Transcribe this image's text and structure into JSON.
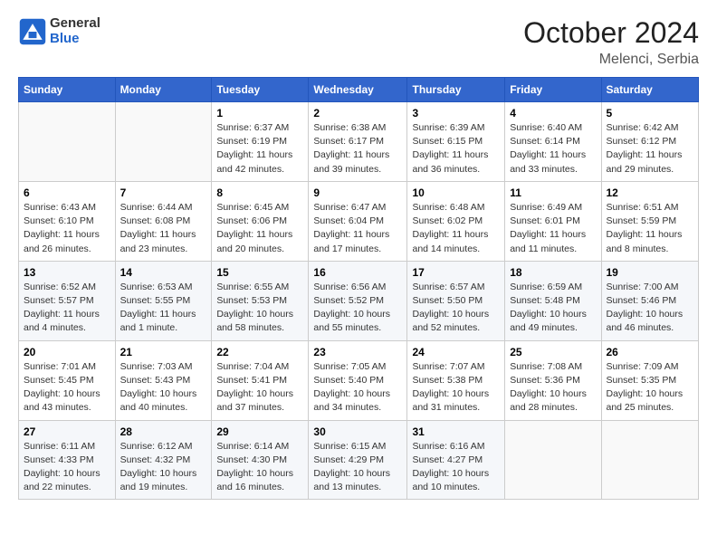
{
  "header": {
    "logo_general": "General",
    "logo_blue": "Blue",
    "month": "October 2024",
    "location": "Melenci, Serbia"
  },
  "weekdays": [
    "Sunday",
    "Monday",
    "Tuesday",
    "Wednesday",
    "Thursday",
    "Friday",
    "Saturday"
  ],
  "weeks": [
    [
      {
        "day": "",
        "info": ""
      },
      {
        "day": "",
        "info": ""
      },
      {
        "day": "1",
        "info": "Sunrise: 6:37 AM\nSunset: 6:19 PM\nDaylight: 11 hours and 42 minutes."
      },
      {
        "day": "2",
        "info": "Sunrise: 6:38 AM\nSunset: 6:17 PM\nDaylight: 11 hours and 39 minutes."
      },
      {
        "day": "3",
        "info": "Sunrise: 6:39 AM\nSunset: 6:15 PM\nDaylight: 11 hours and 36 minutes."
      },
      {
        "day": "4",
        "info": "Sunrise: 6:40 AM\nSunset: 6:14 PM\nDaylight: 11 hours and 33 minutes."
      },
      {
        "day": "5",
        "info": "Sunrise: 6:42 AM\nSunset: 6:12 PM\nDaylight: 11 hours and 29 minutes."
      }
    ],
    [
      {
        "day": "6",
        "info": "Sunrise: 6:43 AM\nSunset: 6:10 PM\nDaylight: 11 hours and 26 minutes."
      },
      {
        "day": "7",
        "info": "Sunrise: 6:44 AM\nSunset: 6:08 PM\nDaylight: 11 hours and 23 minutes."
      },
      {
        "day": "8",
        "info": "Sunrise: 6:45 AM\nSunset: 6:06 PM\nDaylight: 11 hours and 20 minutes."
      },
      {
        "day": "9",
        "info": "Sunrise: 6:47 AM\nSunset: 6:04 PM\nDaylight: 11 hours and 17 minutes."
      },
      {
        "day": "10",
        "info": "Sunrise: 6:48 AM\nSunset: 6:02 PM\nDaylight: 11 hours and 14 minutes."
      },
      {
        "day": "11",
        "info": "Sunrise: 6:49 AM\nSunset: 6:01 PM\nDaylight: 11 hours and 11 minutes."
      },
      {
        "day": "12",
        "info": "Sunrise: 6:51 AM\nSunset: 5:59 PM\nDaylight: 11 hours and 8 minutes."
      }
    ],
    [
      {
        "day": "13",
        "info": "Sunrise: 6:52 AM\nSunset: 5:57 PM\nDaylight: 11 hours and 4 minutes."
      },
      {
        "day": "14",
        "info": "Sunrise: 6:53 AM\nSunset: 5:55 PM\nDaylight: 11 hours and 1 minute."
      },
      {
        "day": "15",
        "info": "Sunrise: 6:55 AM\nSunset: 5:53 PM\nDaylight: 10 hours and 58 minutes."
      },
      {
        "day": "16",
        "info": "Sunrise: 6:56 AM\nSunset: 5:52 PM\nDaylight: 10 hours and 55 minutes."
      },
      {
        "day": "17",
        "info": "Sunrise: 6:57 AM\nSunset: 5:50 PM\nDaylight: 10 hours and 52 minutes."
      },
      {
        "day": "18",
        "info": "Sunrise: 6:59 AM\nSunset: 5:48 PM\nDaylight: 10 hours and 49 minutes."
      },
      {
        "day": "19",
        "info": "Sunrise: 7:00 AM\nSunset: 5:46 PM\nDaylight: 10 hours and 46 minutes."
      }
    ],
    [
      {
        "day": "20",
        "info": "Sunrise: 7:01 AM\nSunset: 5:45 PM\nDaylight: 10 hours and 43 minutes."
      },
      {
        "day": "21",
        "info": "Sunrise: 7:03 AM\nSunset: 5:43 PM\nDaylight: 10 hours and 40 minutes."
      },
      {
        "day": "22",
        "info": "Sunrise: 7:04 AM\nSunset: 5:41 PM\nDaylight: 10 hours and 37 minutes."
      },
      {
        "day": "23",
        "info": "Sunrise: 7:05 AM\nSunset: 5:40 PM\nDaylight: 10 hours and 34 minutes."
      },
      {
        "day": "24",
        "info": "Sunrise: 7:07 AM\nSunset: 5:38 PM\nDaylight: 10 hours and 31 minutes."
      },
      {
        "day": "25",
        "info": "Sunrise: 7:08 AM\nSunset: 5:36 PM\nDaylight: 10 hours and 28 minutes."
      },
      {
        "day": "26",
        "info": "Sunrise: 7:09 AM\nSunset: 5:35 PM\nDaylight: 10 hours and 25 minutes."
      }
    ],
    [
      {
        "day": "27",
        "info": "Sunrise: 6:11 AM\nSunset: 4:33 PM\nDaylight: 10 hours and 22 minutes."
      },
      {
        "day": "28",
        "info": "Sunrise: 6:12 AM\nSunset: 4:32 PM\nDaylight: 10 hours and 19 minutes."
      },
      {
        "day": "29",
        "info": "Sunrise: 6:14 AM\nSunset: 4:30 PM\nDaylight: 10 hours and 16 minutes."
      },
      {
        "day": "30",
        "info": "Sunrise: 6:15 AM\nSunset: 4:29 PM\nDaylight: 10 hours and 13 minutes."
      },
      {
        "day": "31",
        "info": "Sunrise: 6:16 AM\nSunset: 4:27 PM\nDaylight: 10 hours and 10 minutes."
      },
      {
        "day": "",
        "info": ""
      },
      {
        "day": "",
        "info": ""
      }
    ]
  ]
}
